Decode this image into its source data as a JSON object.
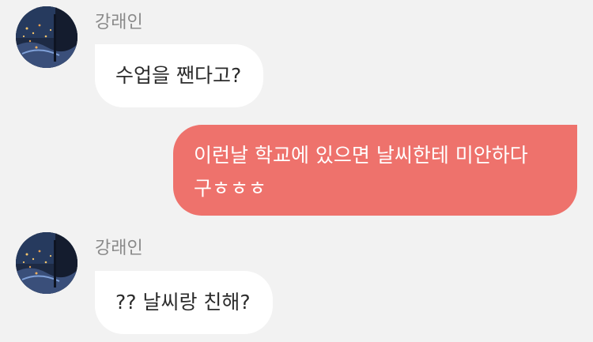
{
  "messages": [
    {
      "direction": "incoming",
      "sender": "강래인",
      "avatar_icon": "night-city-photo-avatar",
      "text": "수업을 짼다고?"
    },
    {
      "direction": "outgoing",
      "lines": [
        "이런날 학교에 있으면 날씨한테 미안하다",
        "구ㅎㅎㅎ"
      ]
    },
    {
      "direction": "incoming",
      "sender": "강래인",
      "avatar_icon": "night-city-photo-avatar",
      "text": "?? 날씨랑 친해?"
    }
  ],
  "colors": {
    "background": "#f2f2f2",
    "incoming_bubble": "#ffffff",
    "outgoing_bubble": "#ee726c",
    "sender_name": "#8a8a8a"
  }
}
